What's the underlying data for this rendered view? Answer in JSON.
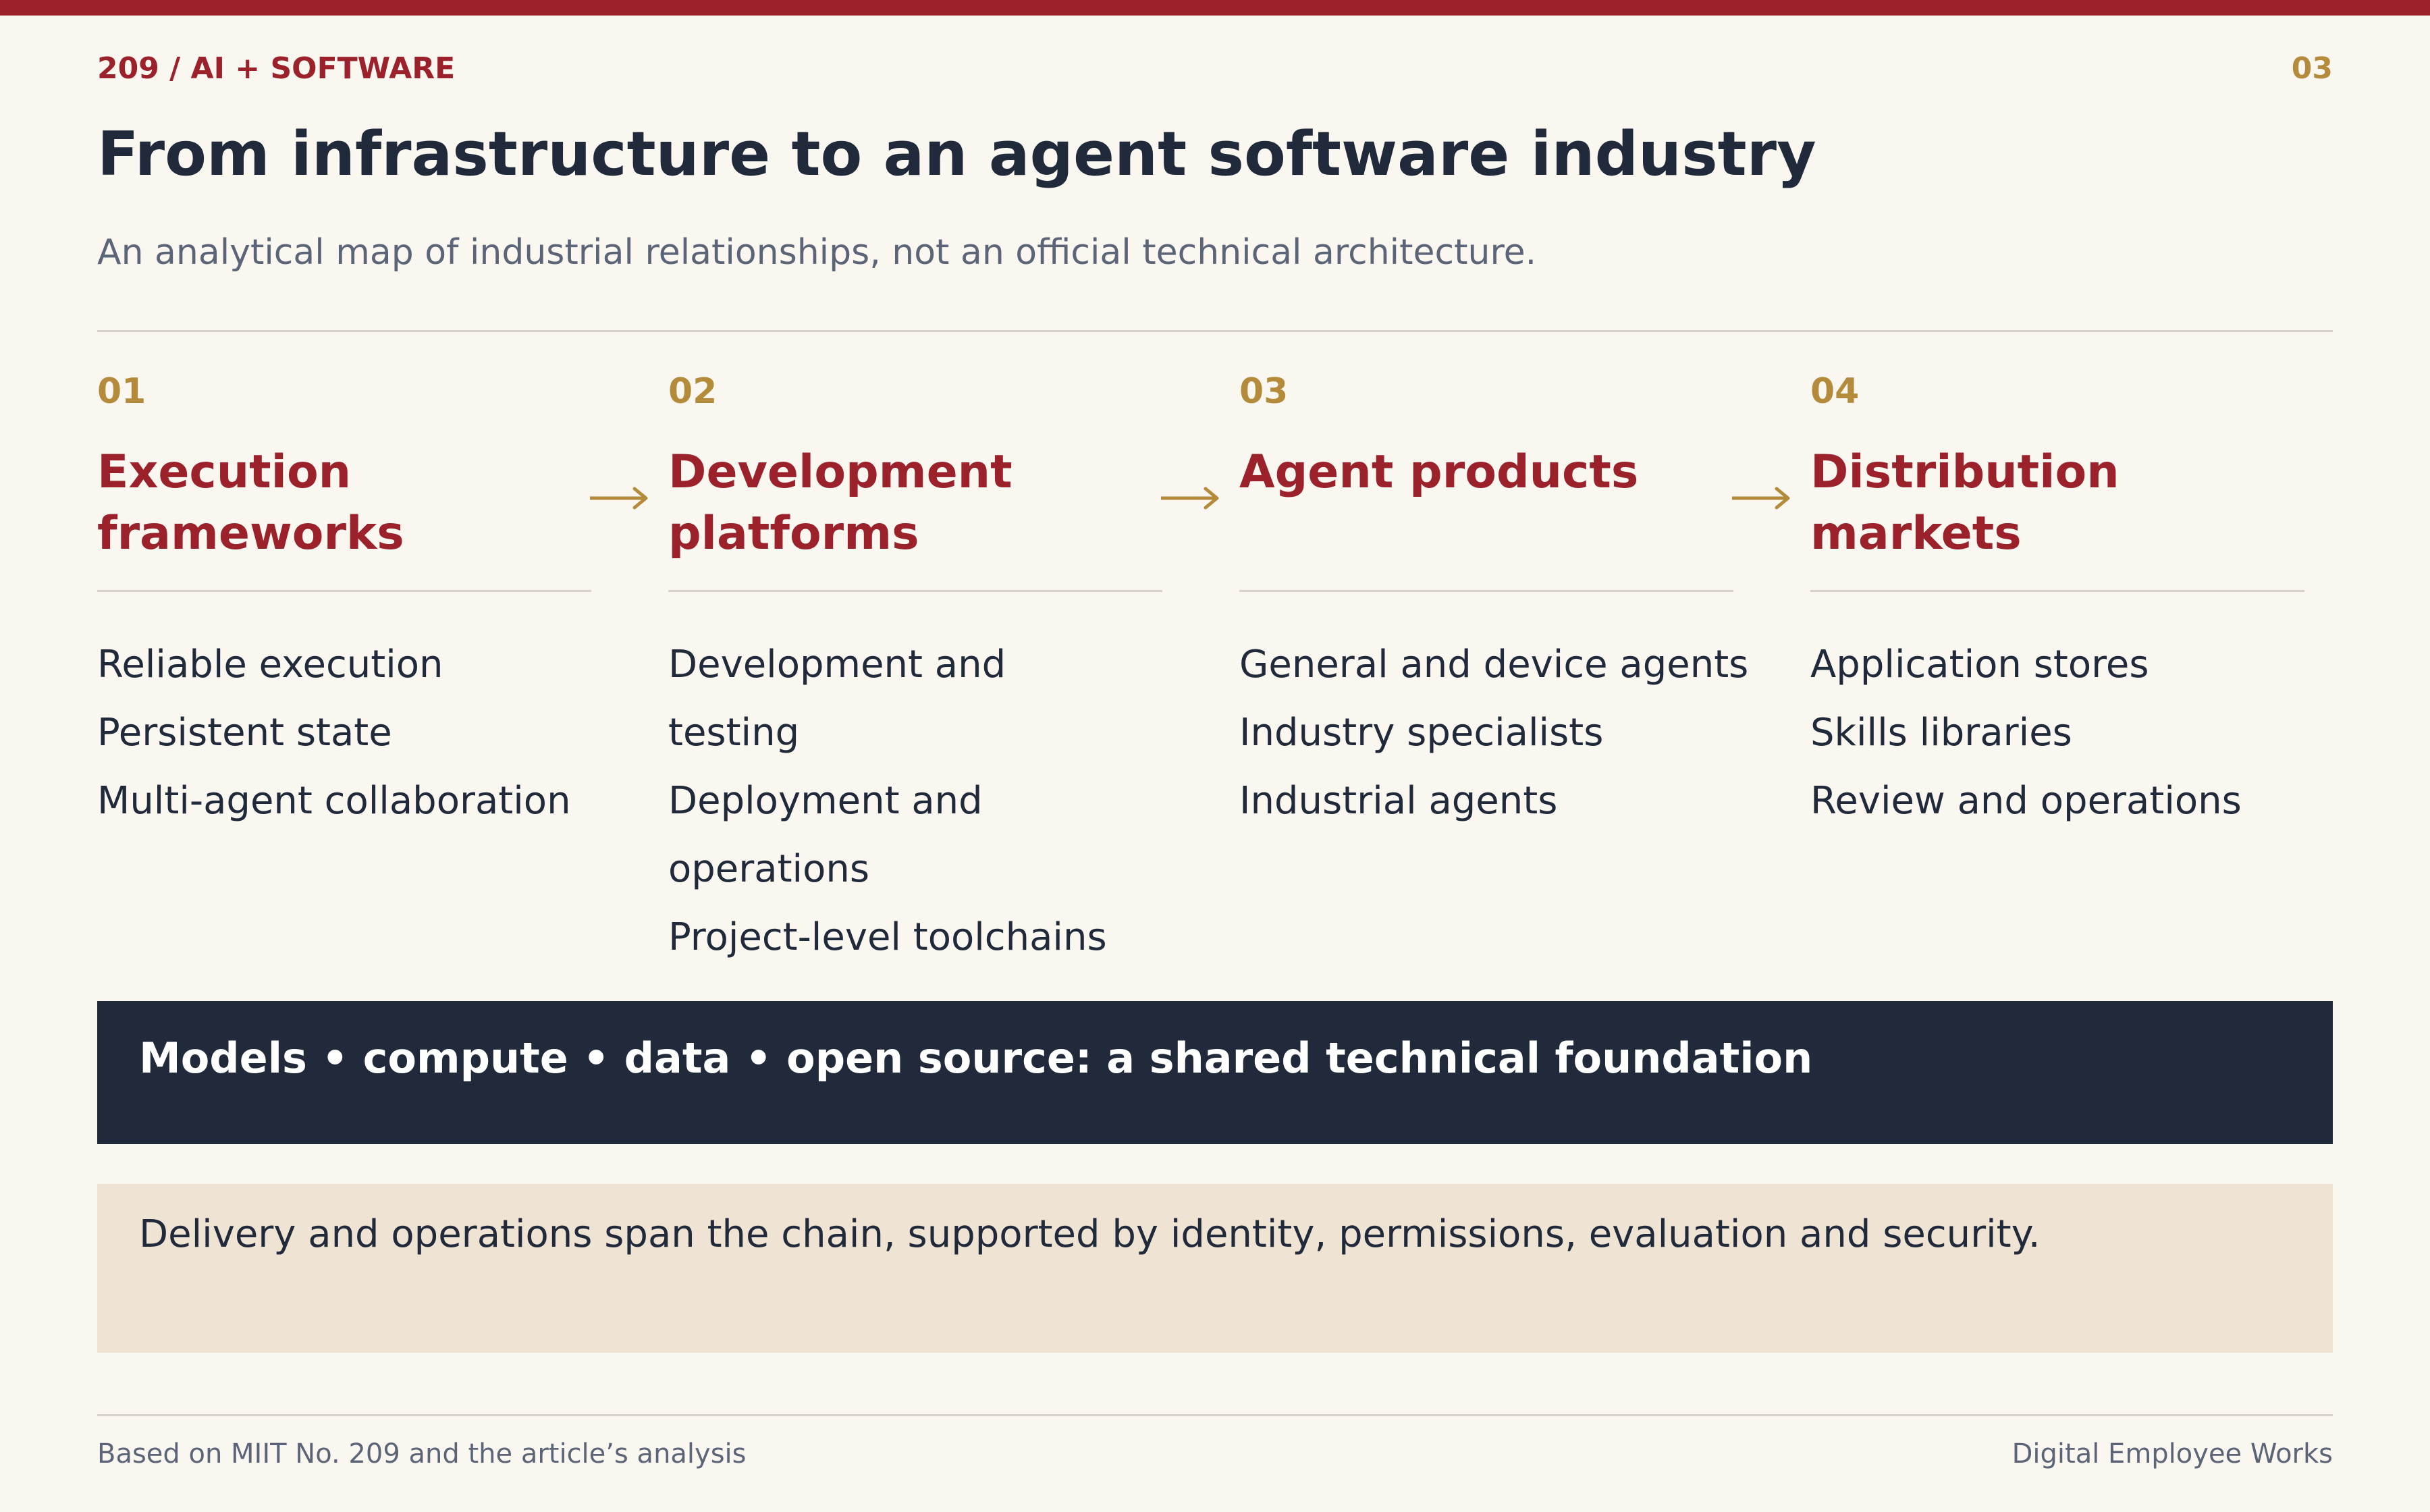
{
  "header": {
    "kicker": "209  /  AI + SOFTWARE",
    "page_number": "03",
    "title": "From infrastructure to an agent software industry",
    "subtitle": "An analytical map of industrial relationships, not an official technical architecture."
  },
  "stages": [
    {
      "number": "01",
      "title": "Execution frameworks",
      "items": [
        "Reliable execution",
        "Persistent state",
        "Multi-agent collaboration"
      ]
    },
    {
      "number": "02",
      "title": "Development platforms",
      "items": [
        "Development and testing",
        "Deployment and operations",
        "Project-level toolchains"
      ]
    },
    {
      "number": "03",
      "title": "Agent products",
      "items": [
        "General and device agents",
        "Industry specialists",
        "Industrial agents"
      ]
    },
    {
      "number": "04",
      "title": "Distribution markets",
      "items": [
        "Application stores",
        "Skills libraries",
        "Review and operations"
      ]
    }
  ],
  "foundation": "Models • compute • data • open source: a shared technical foundation",
  "note": "Delivery and operations span the chain, supported by identity, permissions, evaluation and security.",
  "footer": {
    "source": "Based on MIIT No. 209 and the article’s analysis",
    "brand": "Digital Employee Works"
  },
  "colors": {
    "accent_red": "#9b222b",
    "accent_gold": "#b38b3b",
    "navy": "#212a3b",
    "background": "#faf7f1",
    "note_background": "#efe3d4"
  },
  "icons": {
    "flow_arrow": "right-arrow-icon"
  }
}
